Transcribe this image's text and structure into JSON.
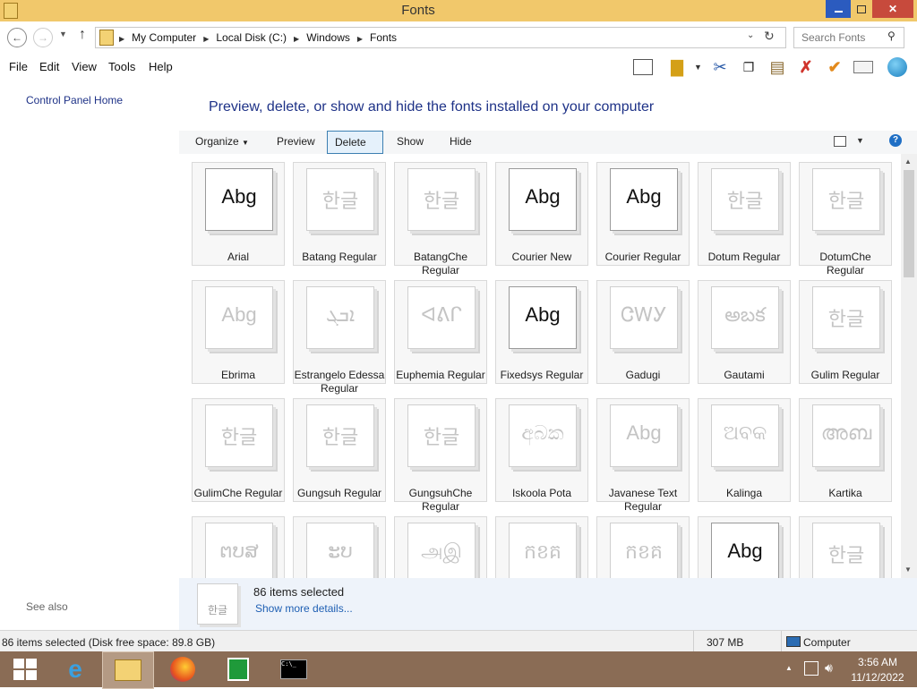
{
  "window": {
    "title": "Fonts"
  },
  "address": {
    "crumbs": [
      "My Computer",
      "Local Disk (C:)",
      "Windows",
      "Fonts"
    ]
  },
  "search": {
    "placeholder": "Search Fonts"
  },
  "menu": {
    "items": [
      "File",
      "Edit",
      "View",
      "Tools",
      "Help"
    ]
  },
  "nav": {
    "home": "Control Panel Home",
    "see_also": "See also"
  },
  "heading": "Preview, delete, or show and hide the fonts installed on your computer",
  "commands": {
    "organize": "Organize",
    "preview": "Preview",
    "delete": "Delete",
    "show": "Show",
    "hide": "Hide"
  },
  "fonts": [
    {
      "name": "Arial",
      "sample": "Abg",
      "dark": true
    },
    {
      "name": "Batang Regular",
      "sample": "한글",
      "dark": false
    },
    {
      "name": "BatangChe Regular",
      "sample": "한글",
      "dark": false
    },
    {
      "name": "Courier New",
      "sample": "Abg",
      "dark": true
    },
    {
      "name": "Courier Regular",
      "sample": "Abg",
      "dark": true
    },
    {
      "name": "Dotum Regular",
      "sample": "한글",
      "dark": false
    },
    {
      "name": "DotumChe Regular",
      "sample": "한글",
      "dark": false
    },
    {
      "name": "Ebrima",
      "sample": "Abg",
      "dark": false
    },
    {
      "name": "Estrangelo Edessa Regular",
      "sample": "ܐܒܓ",
      "dark": false
    },
    {
      "name": "Euphemia Regular",
      "sample": "ᐊᕕᒋ",
      "dark": false
    },
    {
      "name": "Fixedsys Regular",
      "sample": "Abg",
      "dark": true
    },
    {
      "name": "Gadugi",
      "sample": "ᏣᎳᎩ",
      "dark": false
    },
    {
      "name": "Gautami",
      "sample": "అబక",
      "dark": false
    },
    {
      "name": "Gulim Regular",
      "sample": "한글",
      "dark": false
    },
    {
      "name": "GulimChe Regular",
      "sample": "한글",
      "dark": false
    },
    {
      "name": "Gungsuh Regular",
      "sample": "한글",
      "dark": false
    },
    {
      "name": "GungsuhChe Regular",
      "sample": "한글",
      "dark": false
    },
    {
      "name": "Iskoola Pota",
      "sample": "අබක",
      "dark": false
    },
    {
      "name": "Javanese Text Regular",
      "sample": "Abg",
      "dark": false
    },
    {
      "name": "Kalinga",
      "sample": "ଅବକ",
      "dark": false
    },
    {
      "name": "Kartika",
      "sample": "അബ",
      "dark": false
    },
    {
      "name": "",
      "sample": "ຕບສ",
      "dark": false
    },
    {
      "name": "",
      "sample": "ະບ",
      "dark": false
    },
    {
      "name": "",
      "sample": "அஇ",
      "dark": false
    },
    {
      "name": "",
      "sample": "កខគ",
      "dark": false
    },
    {
      "name": "",
      "sample": "កខគ",
      "dark": false
    },
    {
      "name": "",
      "sample": "Abg",
      "dark": true
    },
    {
      "name": "",
      "sample": "한글",
      "dark": false
    }
  ],
  "details": {
    "selected": "86 items selected",
    "more": "Show more details..."
  },
  "status": {
    "left": "86 items selected (Disk free space: 89.8 GB)",
    "size": "307 MB",
    "location": "Computer"
  },
  "clock": {
    "time": "3:56 AM",
    "date": "11/12/2022"
  }
}
